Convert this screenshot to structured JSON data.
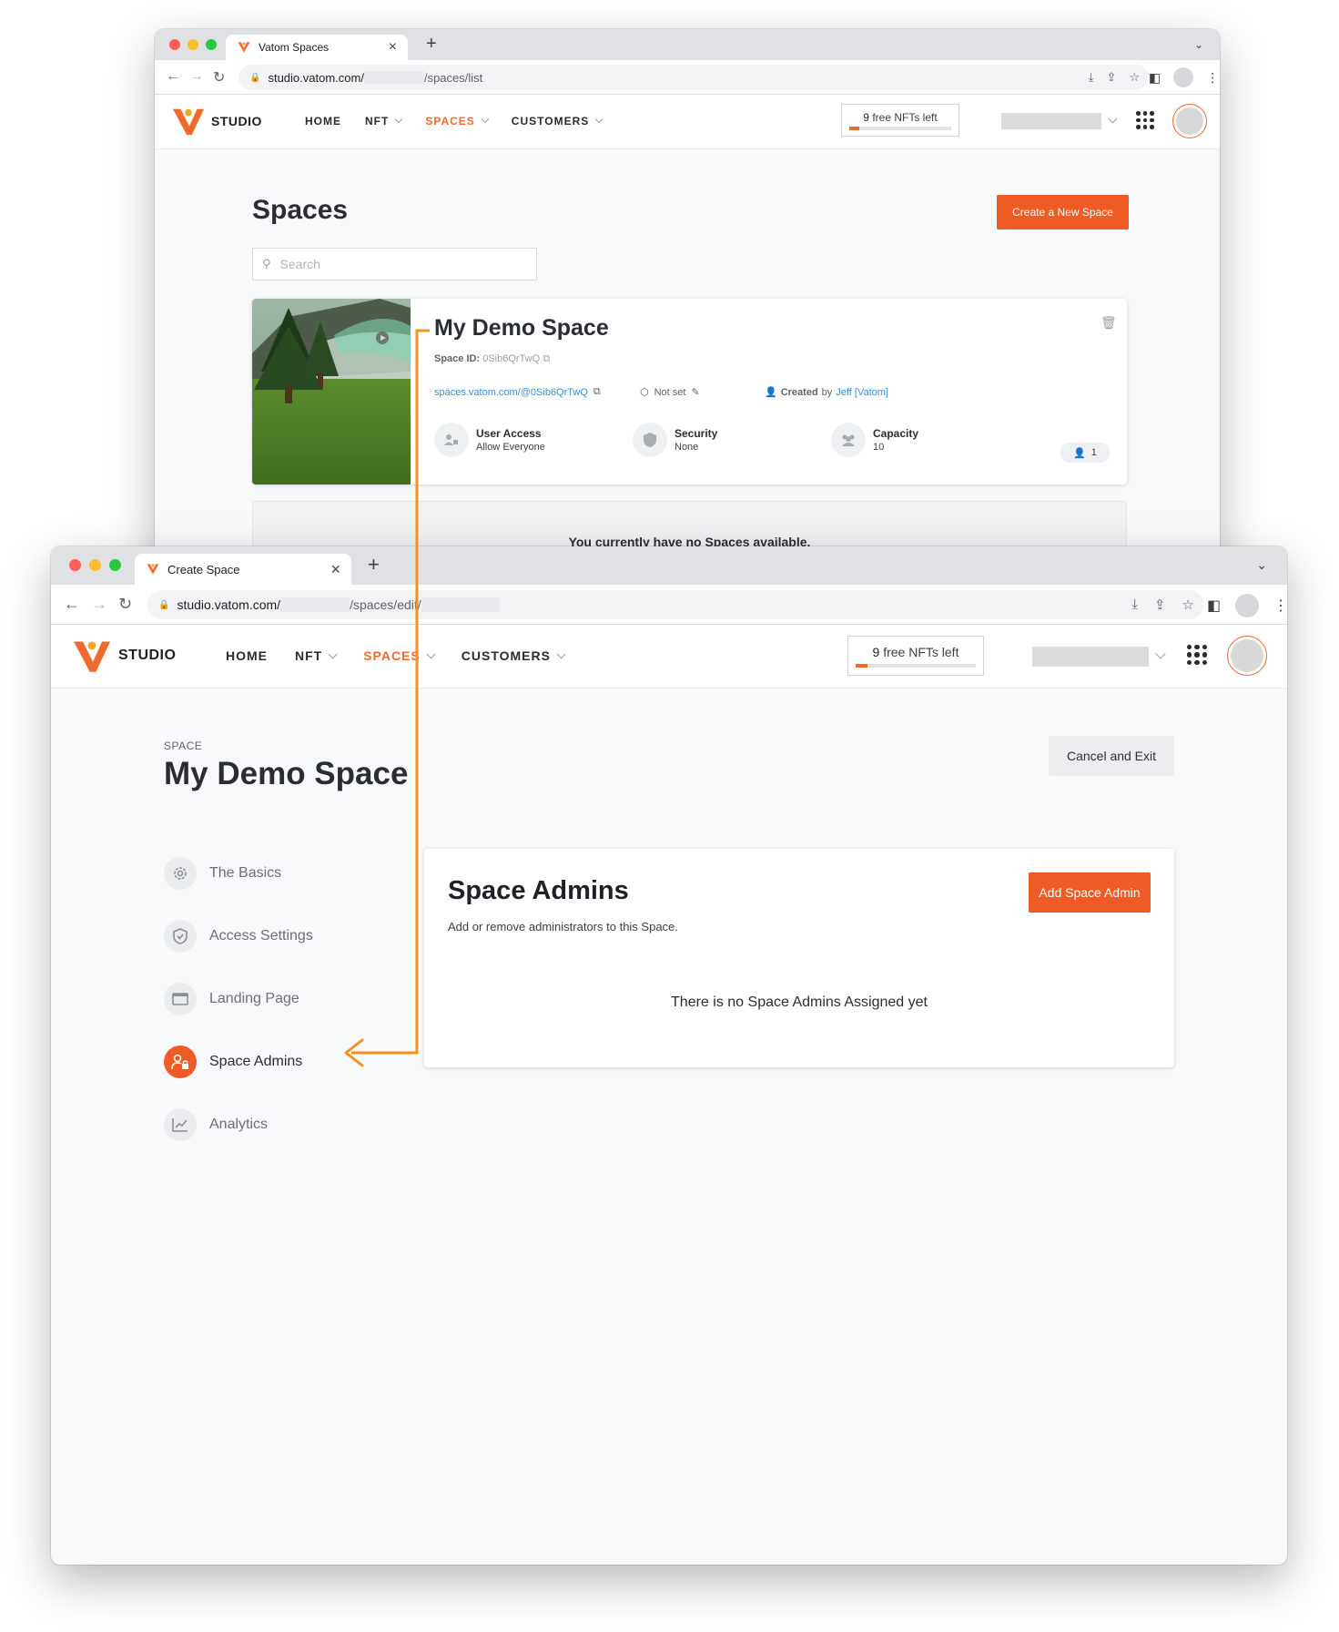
{
  "colors": {
    "brand": "#ee5b25",
    "link": "#3a8dde",
    "connector": "#f59120"
  },
  "back": {
    "tab_title": "Vatom Spaces",
    "url_host": "studio.vatom.com/",
    "url_path": "/spaces/list",
    "logo_text": "STUDIO",
    "nav": [
      "HOME",
      "NFT",
      "SPACES",
      "CUSTOMERS"
    ],
    "nfts_count": "9",
    "nfts_label": "free NFTs left",
    "nfts_progress": 0.1,
    "title": "Spaces",
    "create_button": "Create a New Space",
    "search_placeholder": "Search",
    "card": {
      "name": "My Demo Space",
      "id_label": "Space ID:",
      "id_value": "0Sib6QrTwQ",
      "link": "spaces.vatom.com/@0Sib6QrTwQ",
      "not_set": "Not set",
      "created_label": "Created",
      "created_by": "by",
      "creator": "Jeff [Vatom]",
      "user_access_title": "User Access",
      "user_access_value": "Allow Everyone",
      "security_title": "Security",
      "security_value": "None",
      "capacity_title": "Capacity",
      "capacity_value": "10",
      "users_count": "1"
    },
    "empty_message": "You currently have no Spaces available."
  },
  "front": {
    "tab_title": "Create Space",
    "url_host": "studio.vatom.com/",
    "url_path": "/spaces/edit/",
    "logo_text": "STUDIO",
    "nav": [
      "HOME",
      "NFT",
      "SPACES",
      "CUSTOMERS"
    ],
    "nfts_count": "9",
    "nfts_label": "free NFTs left",
    "nfts_progress": 0.1,
    "crumb": "SPACE",
    "title": "My Demo Space",
    "cancel_button": "Cancel and Exit",
    "sidebar": [
      {
        "label": "The Basics",
        "icon": "gear-icon"
      },
      {
        "label": "Access Settings",
        "icon": "shield-icon"
      },
      {
        "label": "Landing Page",
        "icon": "window-icon"
      },
      {
        "label": "Space Admins",
        "icon": "user-lock-icon",
        "active": true
      },
      {
        "label": "Analytics",
        "icon": "chart-line-icon"
      }
    ],
    "admins": {
      "title": "Space Admins",
      "subtitle": "Add or remove administrators to this Space.",
      "add_button": "Add Space Admin",
      "empty": "There is no Space Admins Assigned yet"
    }
  }
}
